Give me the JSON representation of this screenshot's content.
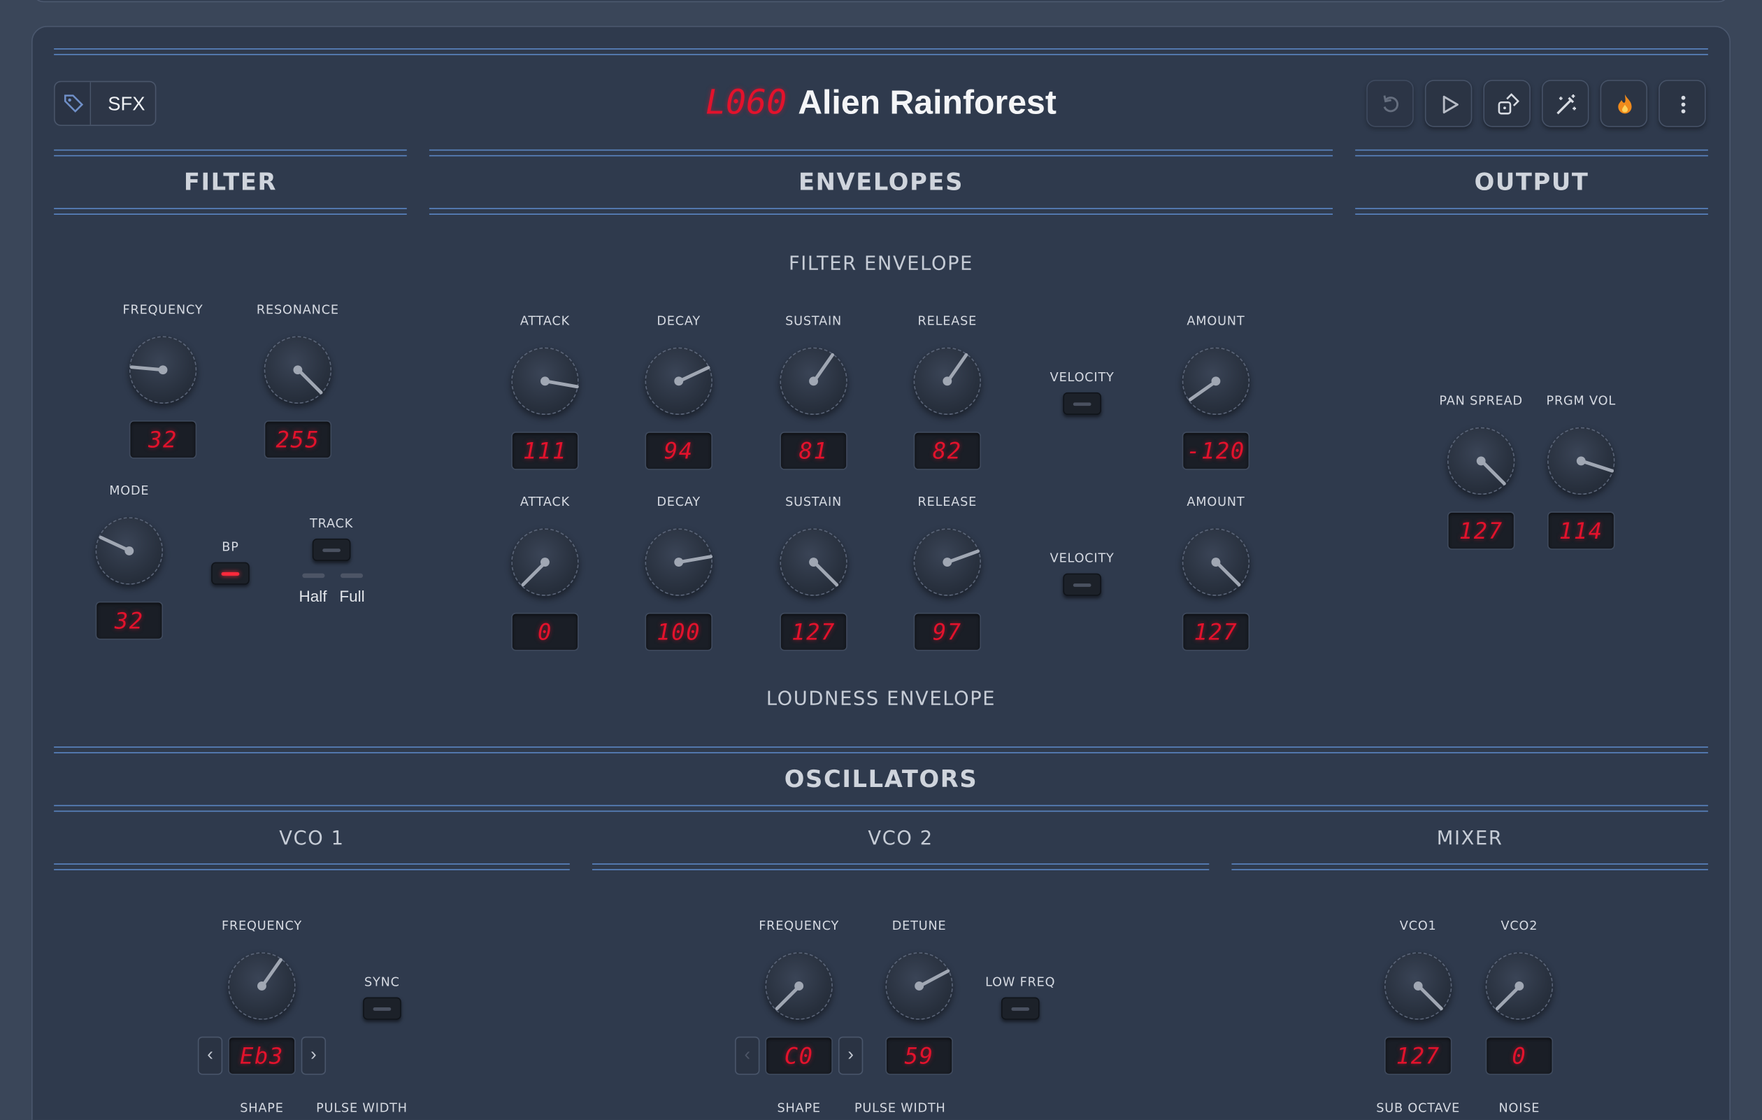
{
  "header": {
    "tag_label": "SFX",
    "patch_number": "L060",
    "patch_name": "Alien Rainforest"
  },
  "sections": {
    "filter": "FILTER",
    "envelopes": "ENVELOPES",
    "output": "OUTPUT",
    "oscillators": "OSCILLATORS",
    "vco1": "VCO 1",
    "vco2": "VCO 2",
    "mixer": "MIXER"
  },
  "filter": {
    "frequency_label": "FREQUENCY",
    "frequency_value": "32",
    "resonance_label": "RESONANCE",
    "resonance_value": "255",
    "mode_label": "MODE",
    "mode_value": "32",
    "bp_label": "BP",
    "track_label": "TRACK",
    "half_label": "Half",
    "full_label": "Full"
  },
  "filter_env": {
    "title": "FILTER ENVELOPE",
    "attack_label": "ATTACK",
    "attack": "111",
    "decay_label": "DECAY",
    "decay": "94",
    "sustain_label": "SUSTAIN",
    "sustain": "81",
    "release_label": "RELEASE",
    "release": "82",
    "velocity_label": "VELOCITY",
    "amount_label": "AMOUNT",
    "amount": "-120"
  },
  "loud_env": {
    "title": "LOUDNESS ENVELOPE",
    "attack_label": "ATTACK",
    "attack": "0",
    "decay_label": "DECAY",
    "decay": "100",
    "sustain_label": "SUSTAIN",
    "sustain": "127",
    "release_label": "RELEASE",
    "release": "97",
    "velocity_label": "VELOCITY",
    "amount_label": "AMOUNT",
    "amount": "127"
  },
  "output": {
    "pan_label": "PAN SPREAD",
    "pan": "127",
    "vol_label": "PRGM VOL",
    "vol": "114"
  },
  "vco1": {
    "frequency_label": "FREQUENCY",
    "note": "Eb3",
    "sync_label": "SYNC",
    "shape_label": "SHAPE",
    "pw_label": "PULSE WIDTH"
  },
  "vco2": {
    "frequency_label": "FREQUENCY",
    "note": "C0",
    "detune_label": "DETUNE",
    "detune": "59",
    "lowfreq_label": "LOW FREQ",
    "shape_label": "SHAPE",
    "pw_label": "PULSE WIDTH"
  },
  "mixer": {
    "vco1_label": "VCO1",
    "vco1": "127",
    "vco2_label": "VCO2",
    "vco2": "0",
    "sub_label": "SUB OCTAVE",
    "noise_label": "NOISE"
  },
  "nav": {
    "prev": "‹",
    "next": "›"
  },
  "icons": [
    "tag-icon",
    "undo-icon",
    "play-icon",
    "dice-icon",
    "magic-wand-icon",
    "fire-icon",
    "more-vertical-icon"
  ],
  "colors": {
    "background": "#3a4659",
    "panel": "#2f3a4d",
    "accent_line": "#5b86c4",
    "led_red": "#e3122c"
  }
}
